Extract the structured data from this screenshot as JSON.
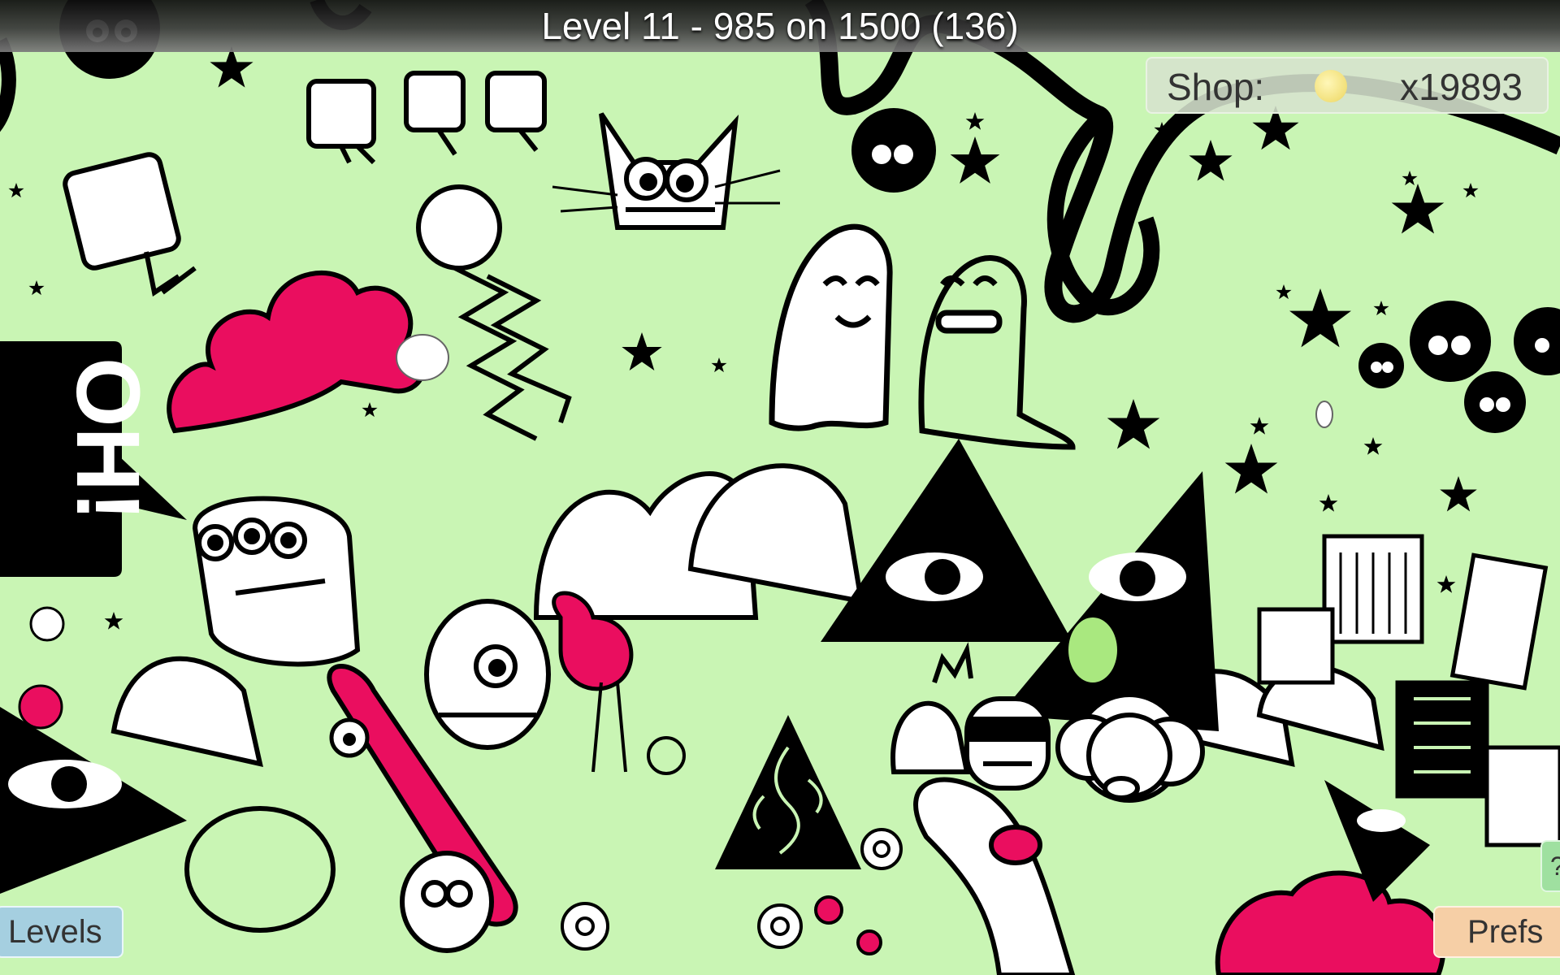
{
  "hud": {
    "level_status": "Level 11 - 985 on 1500 (136)",
    "shop_label": "Shop:",
    "coin_count": "x19893"
  },
  "buttons": {
    "levels": "Levels",
    "prefs": "Prefs",
    "help": "?"
  },
  "scene": {
    "speech_bubble_text": "OH!",
    "icons": [
      "soot-sprite-icon",
      "star-icon",
      "cat-monster-icon",
      "ghost-icon",
      "triangle-eye-icon",
      "pink-cloud-icon",
      "city-buildings-icon",
      "coin-icon",
      "bunny-icon"
    ]
  },
  "colors": {
    "background": "#c9f5b4",
    "accent_pink": "#ea0e5f",
    "ink": "#000000",
    "light_green": "#c9f5b4",
    "levels_button": "#a5cfe0",
    "prefs_button": "#f6cfa6",
    "help_button": "#9fe0a0"
  }
}
